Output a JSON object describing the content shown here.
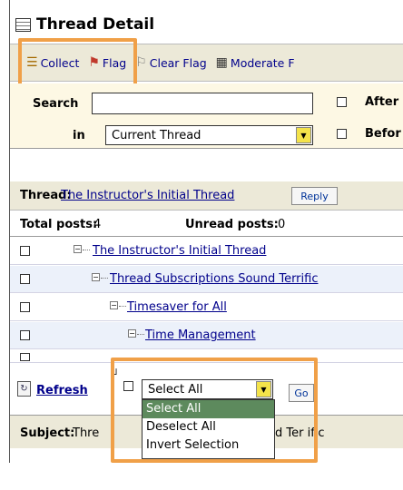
{
  "window": {
    "title": "Thread Detail"
  },
  "toolbar": {
    "collect_label": "Collect",
    "flag_label": "Flag",
    "clear_flag_label": "Clear Flag",
    "moderate_label": "Moderate F"
  },
  "search": {
    "label": "Search",
    "query_value": "",
    "in_label": "in",
    "scope_value": "Current Thread",
    "after_label": "After",
    "before_label": "Befor"
  },
  "thread": {
    "label": "Thread:",
    "title": "The Instructor's Initial Thread",
    "reply_label": "Reply",
    "total_posts_label": "Total posts:",
    "total_posts_value": "4",
    "unread_posts_label": "Unread posts:",
    "unread_posts_value": "0"
  },
  "posts": [
    {
      "title": "The Instructor's Initial Thread",
      "depth": 0
    },
    {
      "title": "Thread Subscriptions Sound Terrific",
      "depth": 1
    },
    {
      "title": "Timesaver for All",
      "depth": 2
    },
    {
      "title": "Time Management",
      "depth": 3
    }
  ],
  "footer": {
    "refresh_label": "Refresh",
    "bulk_select_value": "Select All",
    "go_label": "Go",
    "bulk_options": [
      "Select All",
      "Deselect All",
      "Invert Selection"
    ],
    "selected_option_index": 0
  },
  "subject": {
    "label": "Subject:",
    "text_left": "Thre",
    "text_right": "d Ter ific"
  },
  "colors": {
    "highlight": "#f0a048",
    "link": "#00008b",
    "selected_option": "#5d8a5d"
  }
}
